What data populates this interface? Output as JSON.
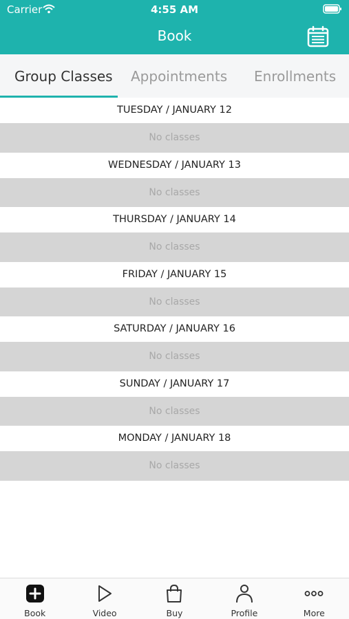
{
  "status_bar": {
    "carrier": "Carrier",
    "time": "4:55 AM"
  },
  "nav": {
    "title": "Book",
    "right_icon": "calendar-icon"
  },
  "tabs": [
    {
      "label": "Group Classes",
      "active": true
    },
    {
      "label": "Appointments",
      "active": false
    },
    {
      "label": "Enrollments",
      "active": false
    }
  ],
  "schedule": [
    {
      "day": "TUESDAY / JANUARY 12",
      "status": "No classes"
    },
    {
      "day": "WEDNESDAY / JANUARY 13",
      "status": "No classes"
    },
    {
      "day": "THURSDAY / JANUARY 14",
      "status": "No classes"
    },
    {
      "day": "FRIDAY / JANUARY 15",
      "status": "No classes"
    },
    {
      "day": "SATURDAY / JANUARY 16",
      "status": "No classes"
    },
    {
      "day": "SUNDAY / JANUARY 17",
      "status": "No classes"
    },
    {
      "day": "MONDAY / JANUARY 18",
      "status": "No classes"
    }
  ],
  "tabbar": [
    {
      "label": "Book",
      "icon": "plus-square-icon"
    },
    {
      "label": "Video",
      "icon": "play-icon"
    },
    {
      "label": "Buy",
      "icon": "shopping-bag-icon"
    },
    {
      "label": "Profile",
      "icon": "person-icon"
    },
    {
      "label": "More",
      "icon": "more-dots-icon"
    }
  ],
  "colors": {
    "accent": "#1eb3ad",
    "empty_row": "#d5d5d5",
    "tab_bg": "#f5f6f7"
  }
}
